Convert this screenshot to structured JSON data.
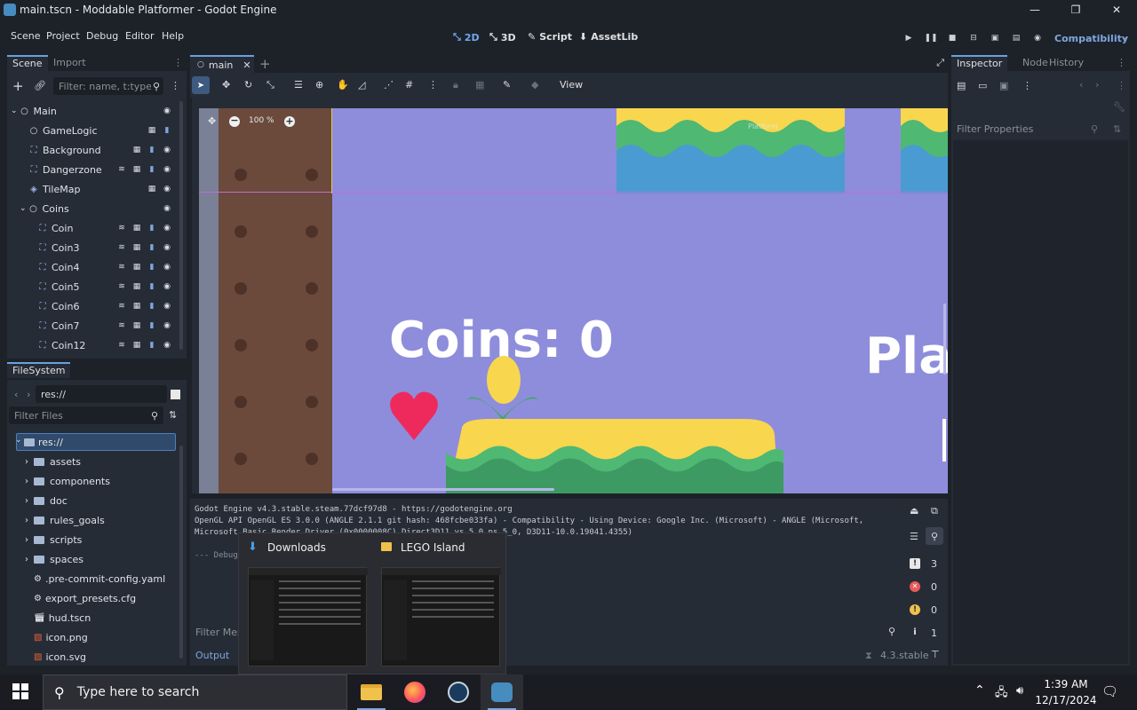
{
  "window": {
    "title": "main.tscn - Moddable Platformer - Godot Engine",
    "min": "—",
    "max": "❐",
    "close": "✕"
  },
  "menu": {
    "items": [
      "Scene",
      "Project",
      "Debug",
      "Editor",
      "Help"
    ]
  },
  "workspaces": {
    "2d": "2D",
    "3d": "3D",
    "script": "Script",
    "assetlib": "AssetLib"
  },
  "renderer": "Compatibility",
  "scene_dock": {
    "tabs": [
      "Scene",
      "Import"
    ],
    "filter_placeholder": "Filter: name, t:type, g:",
    "nodes": [
      {
        "label": "Main",
        "icon": "circle"
      },
      {
        "label": "GameLogic",
        "icon": "circle"
      },
      {
        "label": "Background",
        "icon": "node2d"
      },
      {
        "label": "Dangerzone",
        "icon": "node2d"
      },
      {
        "label": "TileMap",
        "icon": "tilemap"
      },
      {
        "label": "Coins",
        "icon": "circle"
      },
      {
        "label": "Coin",
        "icon": "node2d"
      },
      {
        "label": "Coin3",
        "icon": "node2d"
      },
      {
        "label": "Coin4",
        "icon": "node2d"
      },
      {
        "label": "Coin5",
        "icon": "node2d"
      },
      {
        "label": "Coin6",
        "icon": "node2d"
      },
      {
        "label": "Coin7",
        "icon": "node2d"
      },
      {
        "label": "Coin12",
        "icon": "node2d"
      }
    ]
  },
  "filesystem": {
    "tab": "FileSystem",
    "path": "res://",
    "filter_placeholder": "Filter Files",
    "root": "res://",
    "entries": [
      {
        "label": "assets",
        "type": "folder"
      },
      {
        "label": "components",
        "type": "folder"
      },
      {
        "label": "doc",
        "type": "folder"
      },
      {
        "label": "rules_goals",
        "type": "folder"
      },
      {
        "label": "scripts",
        "type": "folder"
      },
      {
        "label": "spaces",
        "type": "folder"
      },
      {
        "label": ".pre-commit-config.yaml",
        "type": "file"
      },
      {
        "label": "export_presets.cfg",
        "type": "file"
      },
      {
        "label": "hud.tscn",
        "type": "file"
      },
      {
        "label": "icon.png",
        "type": "file"
      },
      {
        "label": "icon.svg",
        "type": "file"
      }
    ]
  },
  "editor": {
    "tab": "main",
    "view_label": "View",
    "zoom": "100 %",
    "canvas_coins_text": "Coins: 0",
    "canvas_partial_text": "Pla",
    "canvas_small_label": "Platform"
  },
  "output": {
    "lines": [
      "Godot Engine v4.3.stable.steam.77dcf97d8 - https://godotengine.org",
      "OpenGL API OpenGL ES 3.0.0 (ANGLE 2.1.1 git hash: 468fcbe033fa) - Compatibility - Using Device: Google Inc. (Microsoft) - ANGLE (Microsoft,",
      "Microsoft Basic Render Driver (0x0000008C) Direct3D11 vs_5_0 ps_5_0, D3D11-10.0.19041.4355)",
      "",
      "--- Debug"
    ],
    "filter_placeholder": "Filter Messages",
    "counts": {
      "messages": "3",
      "errors": "0",
      "warnings": "0",
      "info": "1"
    },
    "bottom_tab": "Output",
    "version": "4.3.stable"
  },
  "inspector": {
    "tabs": [
      "Inspector",
      "Node",
      "History"
    ],
    "filter_placeholder": "Filter Properties"
  },
  "thumbnails": [
    {
      "title": "Downloads"
    },
    {
      "title": "LEGO Island"
    }
  ],
  "taskbar": {
    "search_placeholder": "Type here to search",
    "time": "1:39 AM",
    "date": "12/17/2024"
  },
  "colors": {
    "accent": "#6aa0e0",
    "canvas_bg": "#8e8ddb",
    "heart": "#ee2a5c",
    "yellow": "#f8d64e",
    "green": "#4fb873",
    "brown": "#6b4a3c"
  }
}
